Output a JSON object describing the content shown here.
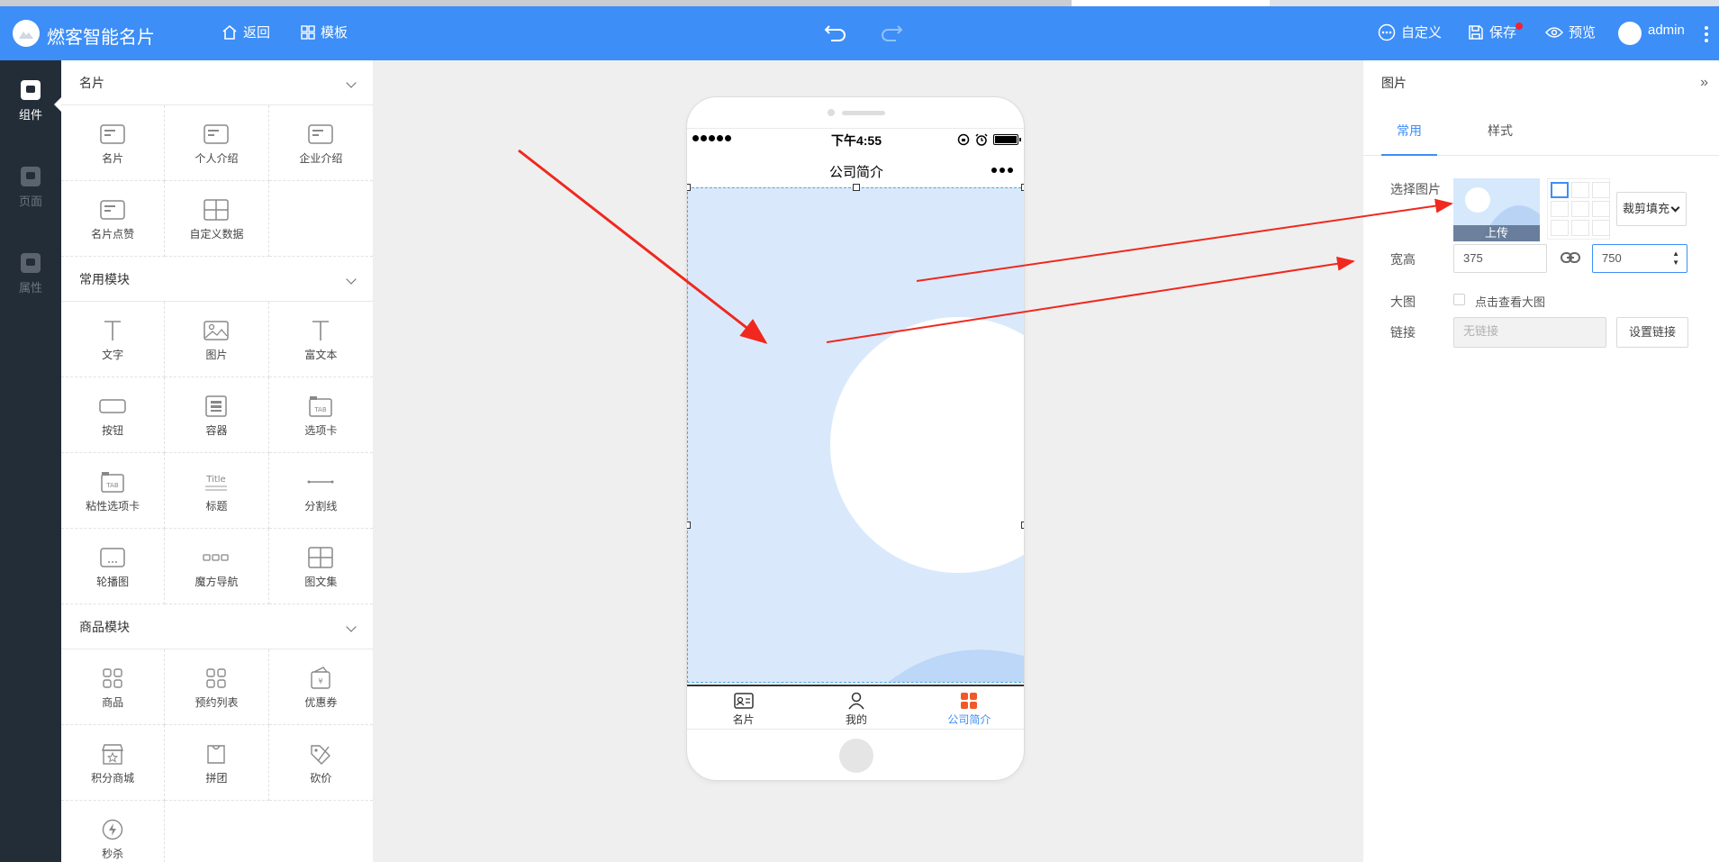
{
  "header": {
    "app_title": "燃客智能名片",
    "back_label": "返回",
    "template_label": "模板",
    "customize_label": "自定义",
    "save_label": "保存",
    "preview_label": "预览",
    "user_name": "admin"
  },
  "rail": {
    "items": [
      {
        "label": "组件",
        "active": true
      },
      {
        "label": "页面",
        "active": false
      },
      {
        "label": "属性",
        "active": false
      }
    ]
  },
  "components": {
    "sections": [
      {
        "title": "名片",
        "items": [
          "名片",
          "个人介绍",
          "企业介绍",
          "名片点赞",
          "自定义数据"
        ]
      },
      {
        "title": "常用模块",
        "items": [
          "文字",
          "图片",
          "富文本",
          "按钮",
          "容器",
          "选项卡",
          "粘性选项卡",
          "标题",
          "分割线",
          "轮播图",
          "魔方导航",
          "图文集"
        ]
      },
      {
        "title": "商品模块",
        "items": [
          "商品",
          "预约列表",
          "优惠券",
          "积分商城",
          "拼团",
          "砍价",
          "秒杀"
        ]
      }
    ]
  },
  "phone": {
    "time": "下午4:55",
    "page_title": "公司简介",
    "tabs": [
      {
        "label": "名片",
        "active": false
      },
      {
        "label": "我的",
        "active": false
      },
      {
        "label": "公司简介",
        "active": true
      }
    ]
  },
  "right_panel": {
    "title": "图片",
    "tabs": [
      "常用",
      "样式"
    ],
    "active_tab": "常用",
    "select_image_label": "选择图片",
    "upload_label": "上传",
    "fill_mode": "裁剪填充",
    "size_label": "宽高",
    "width_value": "375",
    "height_value": "750",
    "big_image_label": "大图",
    "big_image_option": "点击查看大图",
    "link_label": "链接",
    "link_placeholder": "无链接",
    "set_link_button": "设置链接"
  },
  "colors": {
    "primary": "#3d8ef7",
    "rail": "#232d38",
    "arrow": "#f0281e",
    "active_tab": "#3d8ef7"
  }
}
